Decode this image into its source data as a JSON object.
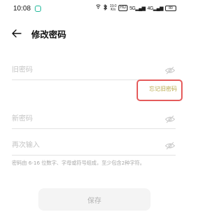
{
  "status_bar": {
    "time": "10:08",
    "network_speed": "19.0\nK/s",
    "hd_badge": "HD",
    "signal_1": "5G",
    "signal_2": "4G",
    "battery": "80"
  },
  "header": {
    "title": "修改密码"
  },
  "form": {
    "old_password": {
      "placeholder": "旧密码",
      "value": ""
    },
    "forgot_link": "忘记旧密码",
    "new_password": {
      "placeholder": "新密码",
      "value": ""
    },
    "confirm_password": {
      "placeholder": "再次输入",
      "value": ""
    },
    "hint": "密码由 6-16 位数字、字母或符号组成，至少包含2种字符。"
  },
  "actions": {
    "save_label": "保存"
  },
  "colors": {
    "forgot_link": "#b8a94a",
    "highlight_border": "#e55b5b",
    "app_indicator": "#1fb89a",
    "button_bg": "#f4f4f4"
  }
}
